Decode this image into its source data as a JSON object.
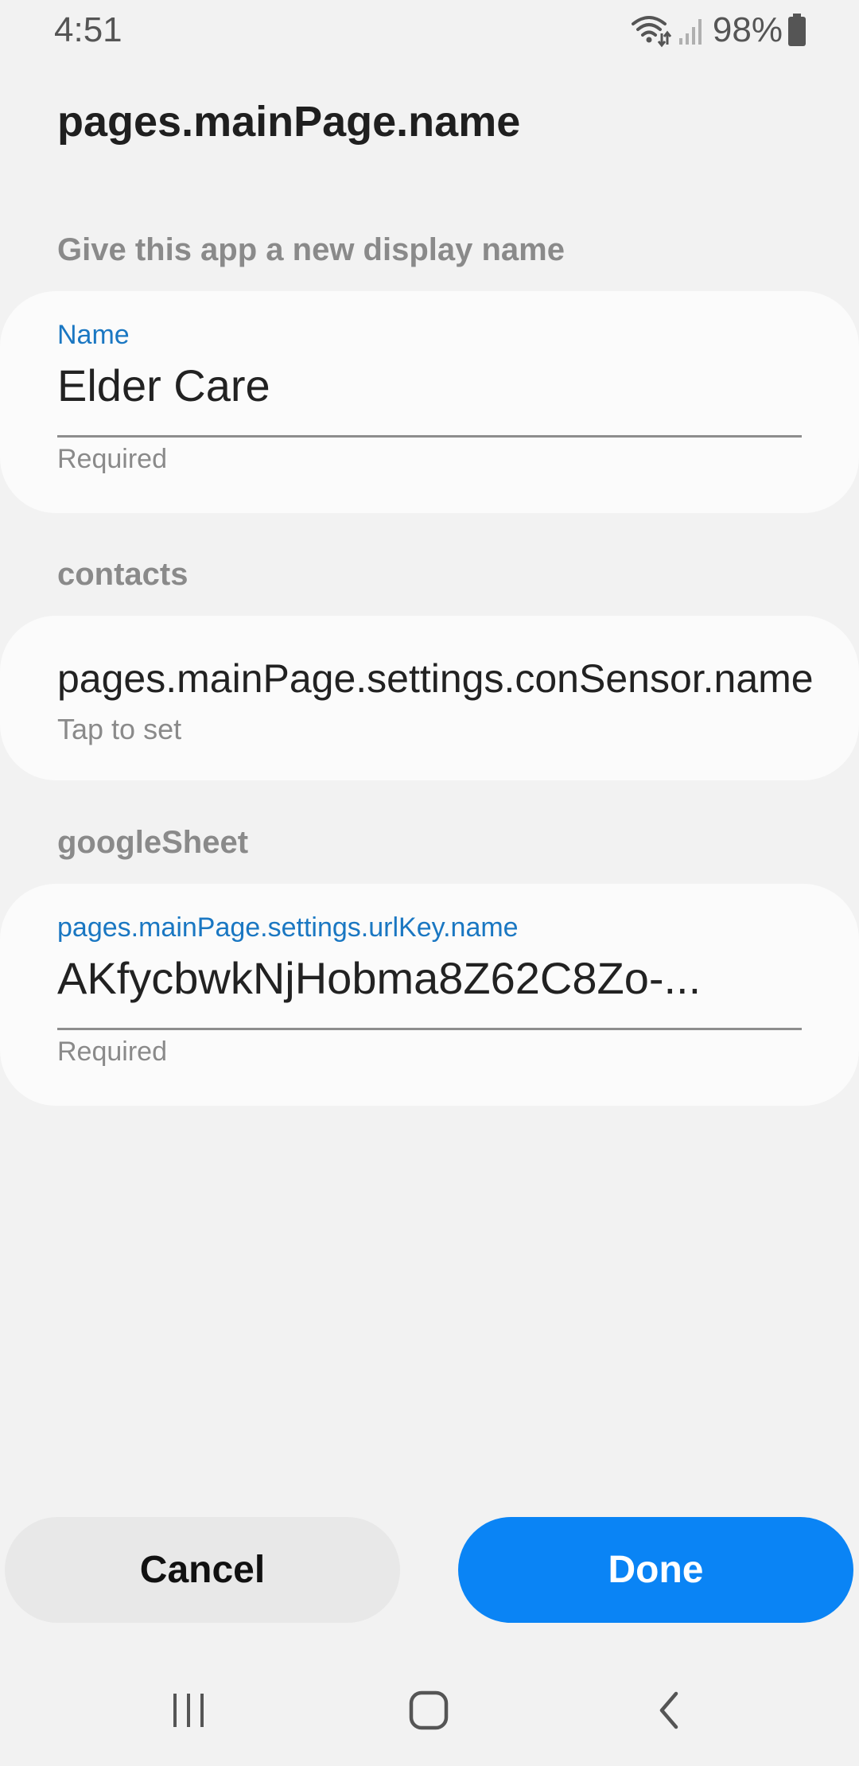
{
  "status_bar": {
    "time": "4:51",
    "battery_percent": "98%",
    "icons": [
      "wifi-icon",
      "signal-icon",
      "battery-icon"
    ]
  },
  "page": {
    "title": "pages.mainPage.name"
  },
  "sections": {
    "display_name_header": "Give this app a new display name",
    "contacts_header": "contacts",
    "google_sheet_header": "googleSheet"
  },
  "name_field": {
    "label": "Name",
    "value": "Elder Care",
    "helper": "Required"
  },
  "contacts_pref": {
    "title": "pages.mainPage.settings.conSensor.name",
    "summary": "Tap to set"
  },
  "url_key_field": {
    "label": "pages.mainPage.settings.urlKey.name",
    "value": "AKfycbwkNjHobma8Z62C8Zo-...",
    "helper": "Required"
  },
  "actions": {
    "cancel_label": "Cancel",
    "done_label": "Done"
  },
  "navigation_bar": {
    "icons": [
      "recent-apps-icon",
      "home-icon",
      "back-icon"
    ]
  },
  "colors": {
    "accent": "#0a84f5",
    "label_blue": "#1a77c2",
    "background": "#f2f2f2",
    "card": "#fbfbfb"
  }
}
